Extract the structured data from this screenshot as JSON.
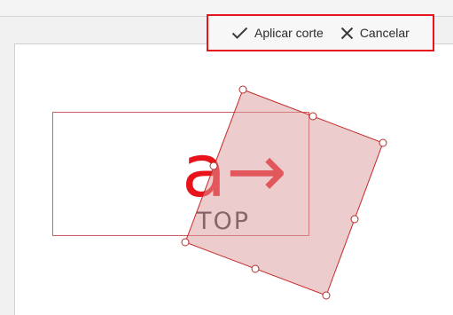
{
  "toolbar": {
    "apply_label": "Aplicar corte",
    "apply_icon": "check-icon",
    "cancel_label": "Cancelar",
    "cancel_icon": "close-icon"
  },
  "image": {
    "logo_mark": "a→",
    "logo_subtext": "TOP"
  },
  "colors": {
    "brand_red": "#e8141c",
    "crop_outline": "#c62828",
    "crop_fill": "#e7c4c4",
    "background": "#f1f1f1"
  }
}
